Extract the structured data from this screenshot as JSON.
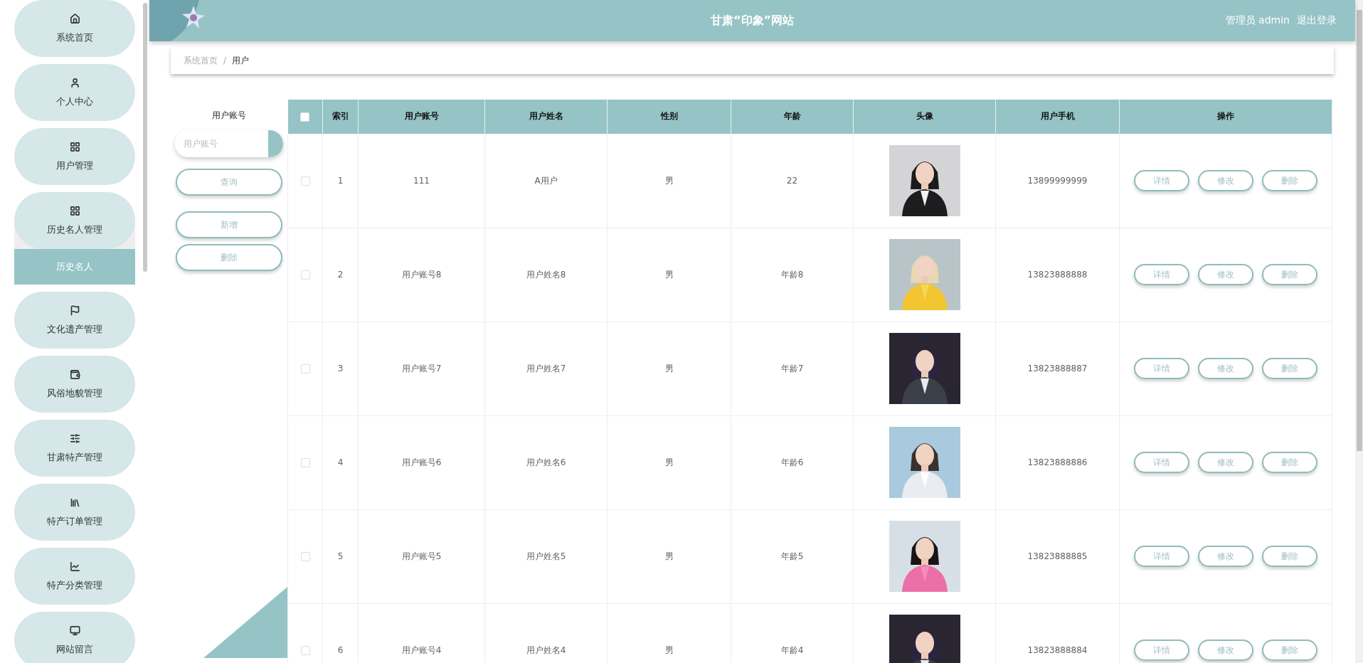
{
  "sidebar": {
    "items": [
      {
        "label": "系统首页",
        "selected": false
      },
      {
        "label": "个人中心",
        "selected": false
      },
      {
        "label": "用户管理",
        "selected": false
      },
      {
        "label": "历史名人管理",
        "selected": false,
        "expanded": true,
        "children": [
          {
            "label": "历史名人",
            "selected": true
          }
        ]
      },
      {
        "label": "文化遗产管理",
        "selected": false
      },
      {
        "label": "风俗地貌管理",
        "selected": false
      },
      {
        "label": "甘肃特产管理",
        "selected": false
      },
      {
        "label": "特产订单管理",
        "selected": false
      },
      {
        "label": "特产分类管理",
        "selected": false
      },
      {
        "label": "网站留言",
        "selected": false
      }
    ]
  },
  "header": {
    "title": "甘肃“印象”网站",
    "user": "管理员 admin",
    "logout": "退出登录"
  },
  "breadcrumb": {
    "separator": "/",
    "items": [
      {
        "label": "系统首页",
        "current": false
      },
      {
        "label": "用户",
        "current": true
      }
    ]
  },
  "search": {
    "label": "用户账号",
    "placeholder": "用户账号",
    "search_button": "查询",
    "actions": [
      "新增",
      "删除"
    ]
  },
  "table": {
    "select_all_checked": false,
    "columns": [
      "索引",
      "用户账号",
      "用户姓名",
      "性别",
      "年龄",
      "头像",
      "用户手机",
      "操作"
    ],
    "rows": [
      {
        "checked": false,
        "cells": [
          "1",
          "111",
          "A用户",
          "男",
          "22"
        ],
        "phone": "13899999999",
        "actions": [
          "详情",
          "修改",
          "删除"
        ]
      },
      {
        "checked": false,
        "cells": [
          "2",
          "用户账号8",
          "用户姓名8",
          "男",
          "年龄8"
        ],
        "phone": "13823888888",
        "actions": [
          "详情",
          "修改",
          "删除"
        ]
      },
      {
        "checked": false,
        "cells": [
          "3",
          "用户账号7",
          "用户姓名7",
          "男",
          "年龄7"
        ],
        "phone": "13823888887",
        "actions": [
          "详情",
          "修改",
          "删除"
        ]
      },
      {
        "checked": false,
        "cells": [
          "4",
          "用户账号6",
          "用户姓名6",
          "男",
          "年龄6"
        ],
        "phone": "13823888886",
        "actions": [
          "详情",
          "修改",
          "删除"
        ]
      },
      {
        "checked": false,
        "cells": [
          "5",
          "用户账号5",
          "用户姓名5",
          "男",
          "年龄5"
        ],
        "phone": "13823888885",
        "actions": [
          "详情",
          "修改",
          "删除"
        ]
      },
      {
        "checked": false,
        "cells": [
          "6",
          "用户账号4",
          "用户姓名4",
          "男",
          "年龄4"
        ],
        "phone": "13823888884",
        "actions": [
          "详情",
          "修改",
          "删除"
        ]
      }
    ]
  }
}
